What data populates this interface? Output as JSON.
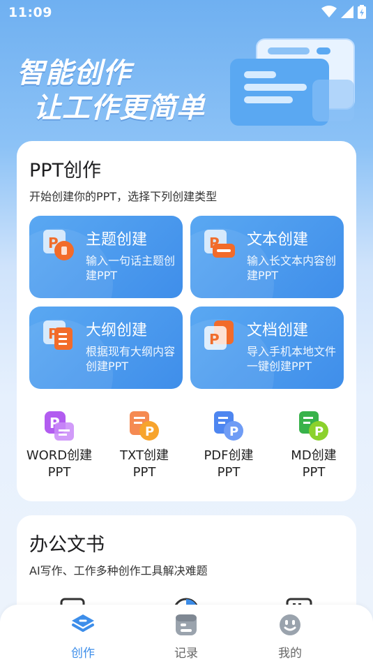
{
  "status_bar": {
    "time": "11:09"
  },
  "hero": {
    "line1": "智能创作",
    "line2": "让工作更简单"
  },
  "ppt_section": {
    "title": "PPT创作",
    "subtitle": "开始创建你的PPT，选择下列创建类型",
    "tiles": [
      {
        "name": "主题创建",
        "desc": "输入一句话主题创建PPT"
      },
      {
        "name": "文本创建",
        "desc": "输入长文本内容创建PPT"
      },
      {
        "name": "大纲创建",
        "desc": "根据现有大纲内容创建PPT"
      },
      {
        "name": "文档创建",
        "desc": "导入手机本地文件一键创建PPT"
      }
    ],
    "small": [
      {
        "line1": "WORD创建",
        "line2": "PPT"
      },
      {
        "line1": "TXT创建",
        "line2": "PPT"
      },
      {
        "line1": "PDF创建",
        "line2": "PPT"
      },
      {
        "line1": "MD创建",
        "line2": "PPT"
      }
    ]
  },
  "office_section": {
    "title": "办公文书",
    "subtitle": "AI写作、工作多种创作工具解决难题"
  },
  "tabs": [
    {
      "label": "创作",
      "icon": "layers-icon",
      "active": true
    },
    {
      "label": "记录",
      "icon": "record-icon",
      "active": false
    },
    {
      "label": "我的",
      "icon": "smiley-icon",
      "active": false
    }
  ],
  "colors": {
    "accent": "#3d8eea",
    "tab_inactive": "#666666"
  }
}
